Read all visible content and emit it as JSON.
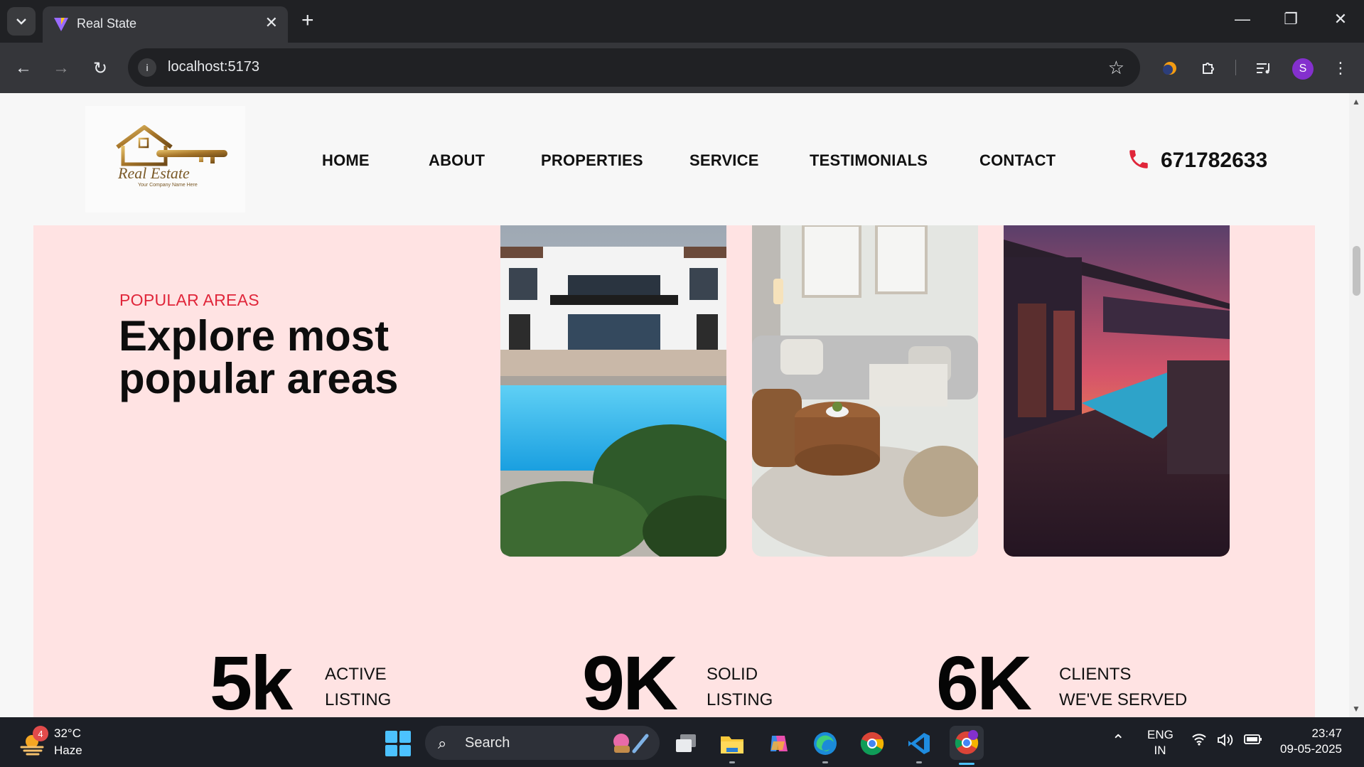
{
  "browser": {
    "tab_title": "Real State",
    "tab_close": "✕",
    "new_tab": "+",
    "url": "localhost:5173",
    "profile_initial": "S"
  },
  "site": {
    "logo_text": "Real Estate",
    "logo_subtext": "Your Company Name Here",
    "nav": [
      "HOME",
      "ABOUT",
      "PROPERTIES",
      "SERVICE",
      "TESTIMONIALS",
      "CONTACT"
    ],
    "phone": "671782633",
    "accent_color": "#e0263a",
    "section_bg": "#ffe3e3"
  },
  "popular": {
    "eyebrow": "POPULAR AREAS",
    "headline_line1": "Explore most",
    "headline_line2": "popular areas",
    "cards": [
      {
        "image": "modern-villa-with-pool"
      },
      {
        "image": "living-room-interior"
      },
      {
        "image": "deck-pool-at-sunset"
      }
    ]
  },
  "stats": [
    {
      "value": "5k",
      "label_line1": "ACTIVE",
      "label_line2": "LISTING"
    },
    {
      "value": "9K",
      "label_line1": "SOLID",
      "label_line2": "LISTING"
    },
    {
      "value": "6K",
      "label_line1": "CLIENTS",
      "label_line2": "WE'VE SERVED"
    }
  ],
  "taskbar": {
    "weather_badge": "4",
    "temperature": "32°C",
    "condition": "Haze",
    "search_label": "Search",
    "lang_line1": "ENG",
    "lang_line2": "IN",
    "time": "23:47",
    "date": "09-05-2025"
  }
}
